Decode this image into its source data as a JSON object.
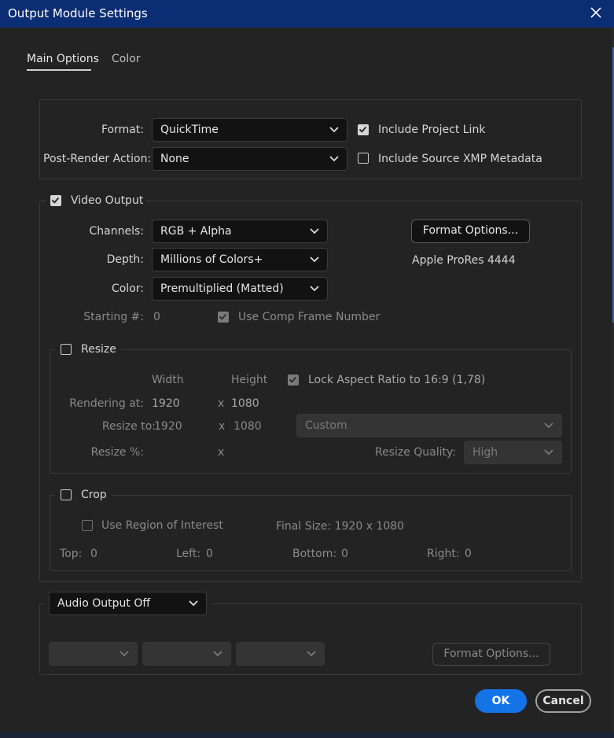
{
  "window": {
    "title": "Output Module Settings"
  },
  "tabs": [
    {
      "label": "Main Options"
    },
    {
      "label": "Color"
    }
  ],
  "format_section": {
    "format_label": "Format:",
    "format_value": "QuickTime",
    "post_render_label": "Post-Render Action:",
    "post_render_value": "None",
    "include_project_link": {
      "label": "Include Project Link",
      "checked": true
    },
    "include_xmp": {
      "label": "Include Source XMP Metadata",
      "checked": false
    }
  },
  "video_output": {
    "label": "Video Output",
    "checked": true,
    "channels_label": "Channels:",
    "channels_value": "RGB + Alpha",
    "depth_label": "Depth:",
    "depth_value": "Millions of Colors+",
    "color_label": "Color:",
    "color_value": "Premultiplied (Matted)",
    "format_options_label": "Format Options...",
    "codec_text": "Apple ProRes 4444",
    "starting_label": "Starting #:",
    "starting_value": "0",
    "use_comp_frame": {
      "label": "Use Comp Frame Number",
      "checked": true
    }
  },
  "resize": {
    "label": "Resize",
    "checked": false,
    "width_header": "Width",
    "height_header": "Height",
    "lock_aspect": {
      "label": "Lock Aspect Ratio to 16:9 (1,78)",
      "checked": true
    },
    "rendering_label": "Rendering at:",
    "rendering_w": "1920",
    "rendering_h": "1080",
    "resize_to_label": "Resize to:",
    "resize_to_w": "1920",
    "resize_to_h": "1080",
    "x_sep": "x",
    "preset_value": "Custom",
    "resize_pct_label": "Resize %:",
    "quality_label": "Resize Quality:",
    "quality_value": "High"
  },
  "crop": {
    "label": "Crop",
    "checked": false,
    "use_roi": {
      "label": "Use Region of Interest",
      "checked": false
    },
    "final_size": "Final Size: 1920 x 1080",
    "top_label": "Top:",
    "top_value": "0",
    "left_label": "Left:",
    "left_value": "0",
    "bottom_label": "Bottom:",
    "bottom_value": "0",
    "right_label": "Right:",
    "right_value": "0"
  },
  "audio": {
    "output_value": "Audio Output Off",
    "format_options_label": "Format Options..."
  },
  "footer": {
    "ok_label": "OK",
    "cancel_label": "Cancel"
  },
  "colors": {
    "titlebar": "#0b2d74",
    "accent": "#1473e6",
    "background": "#232323"
  },
  "icons": [
    "close-icon",
    "chevron-down-icon",
    "checkmark-icon"
  ]
}
